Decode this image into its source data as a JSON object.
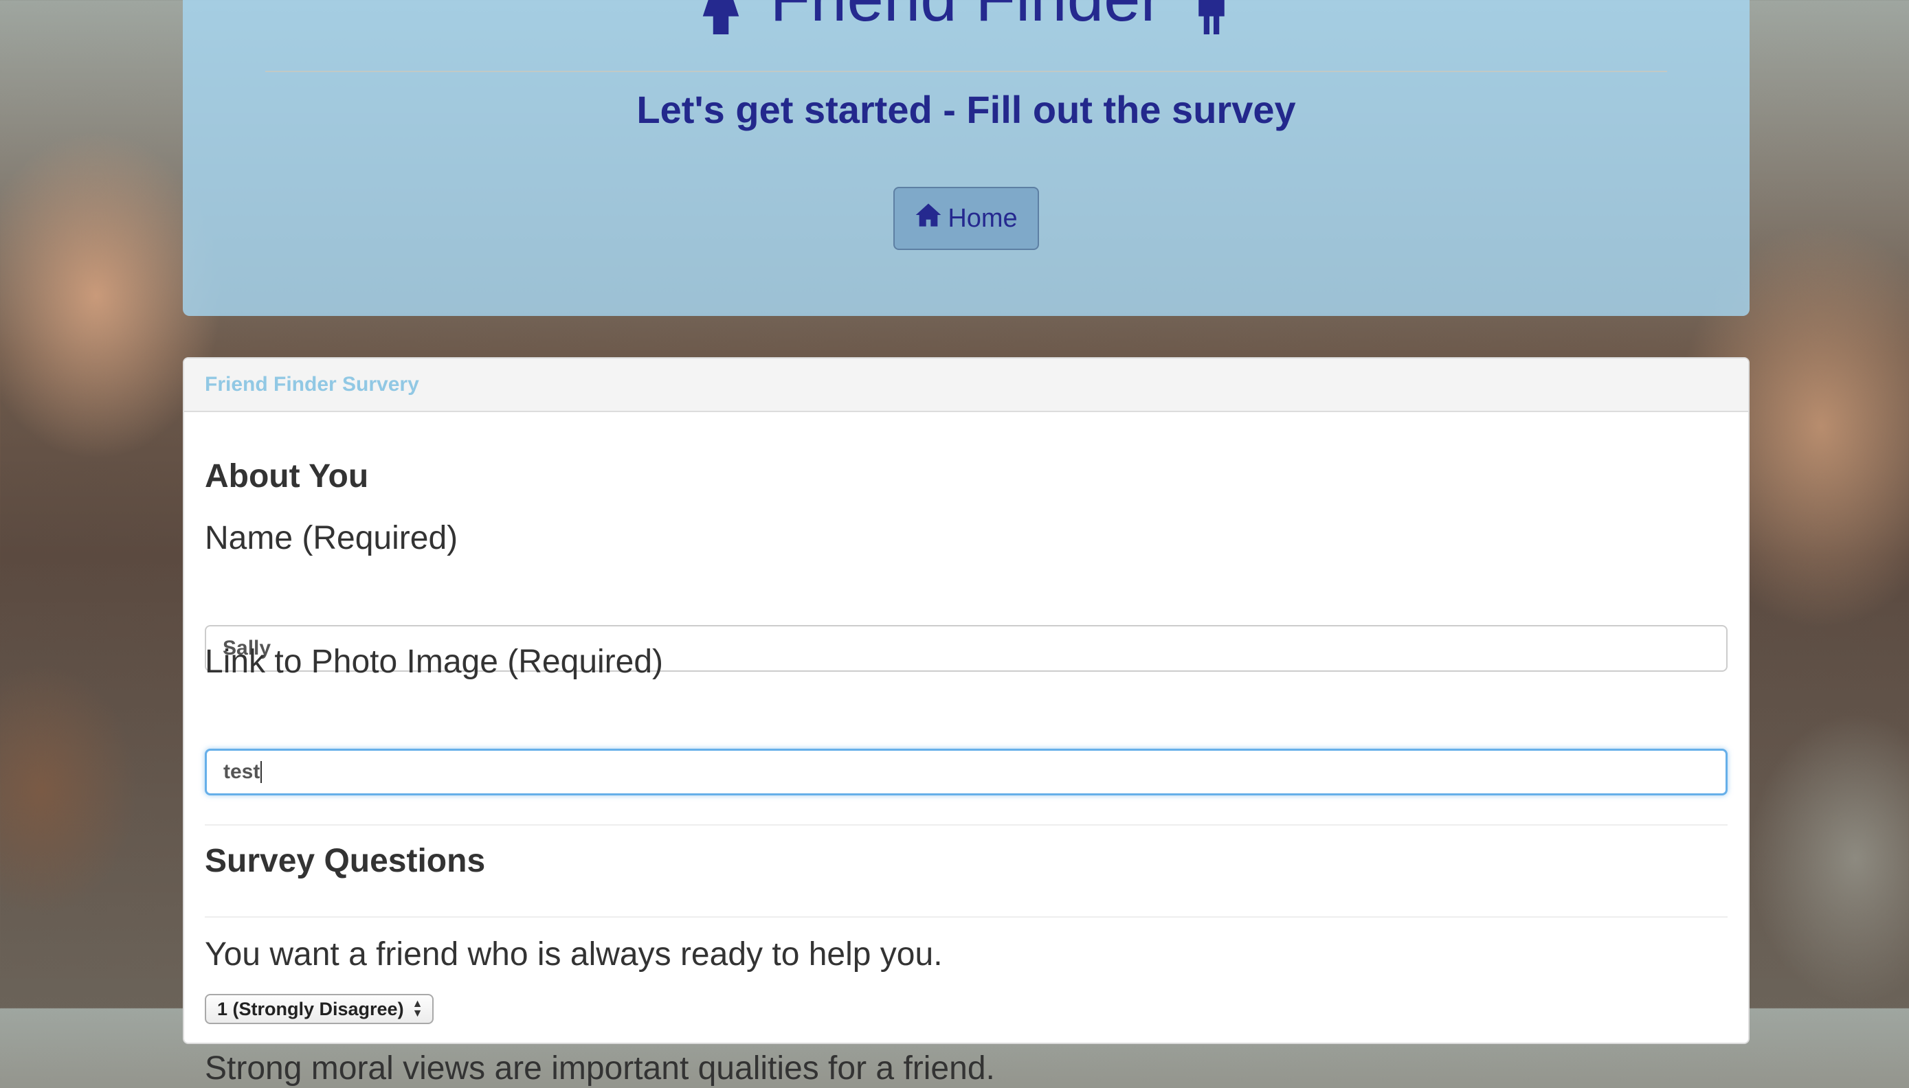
{
  "header": {
    "title": "Friend Finder",
    "left_icon": "female-person-icon",
    "right_icon": "male-person-icon",
    "subtitle": "Let's get started - Fill out the survey",
    "home_button": {
      "label": "Home",
      "icon": "home-icon"
    }
  },
  "panel": {
    "heading": "Friend Finder Survery",
    "about_section": {
      "title": "About You",
      "name_label": "Name (Required)",
      "name_value": "Sally",
      "photo_label": "Link to Photo Image (Required)",
      "photo_value": "test"
    },
    "survey_section": {
      "title": "Survey Questions",
      "questions": [
        {
          "text": "You want a friend who is always ready to help you.",
          "selected": "1 (Strongly Disagree)"
        },
        {
          "text": "Strong moral views are important qualities for a friend."
        }
      ]
    }
  },
  "colors": {
    "title_color": "#25298f",
    "jumbotron_bg": "#a6d5f0",
    "panel_heading_text": "#91c8e4",
    "focus_border": "#66afe9"
  }
}
